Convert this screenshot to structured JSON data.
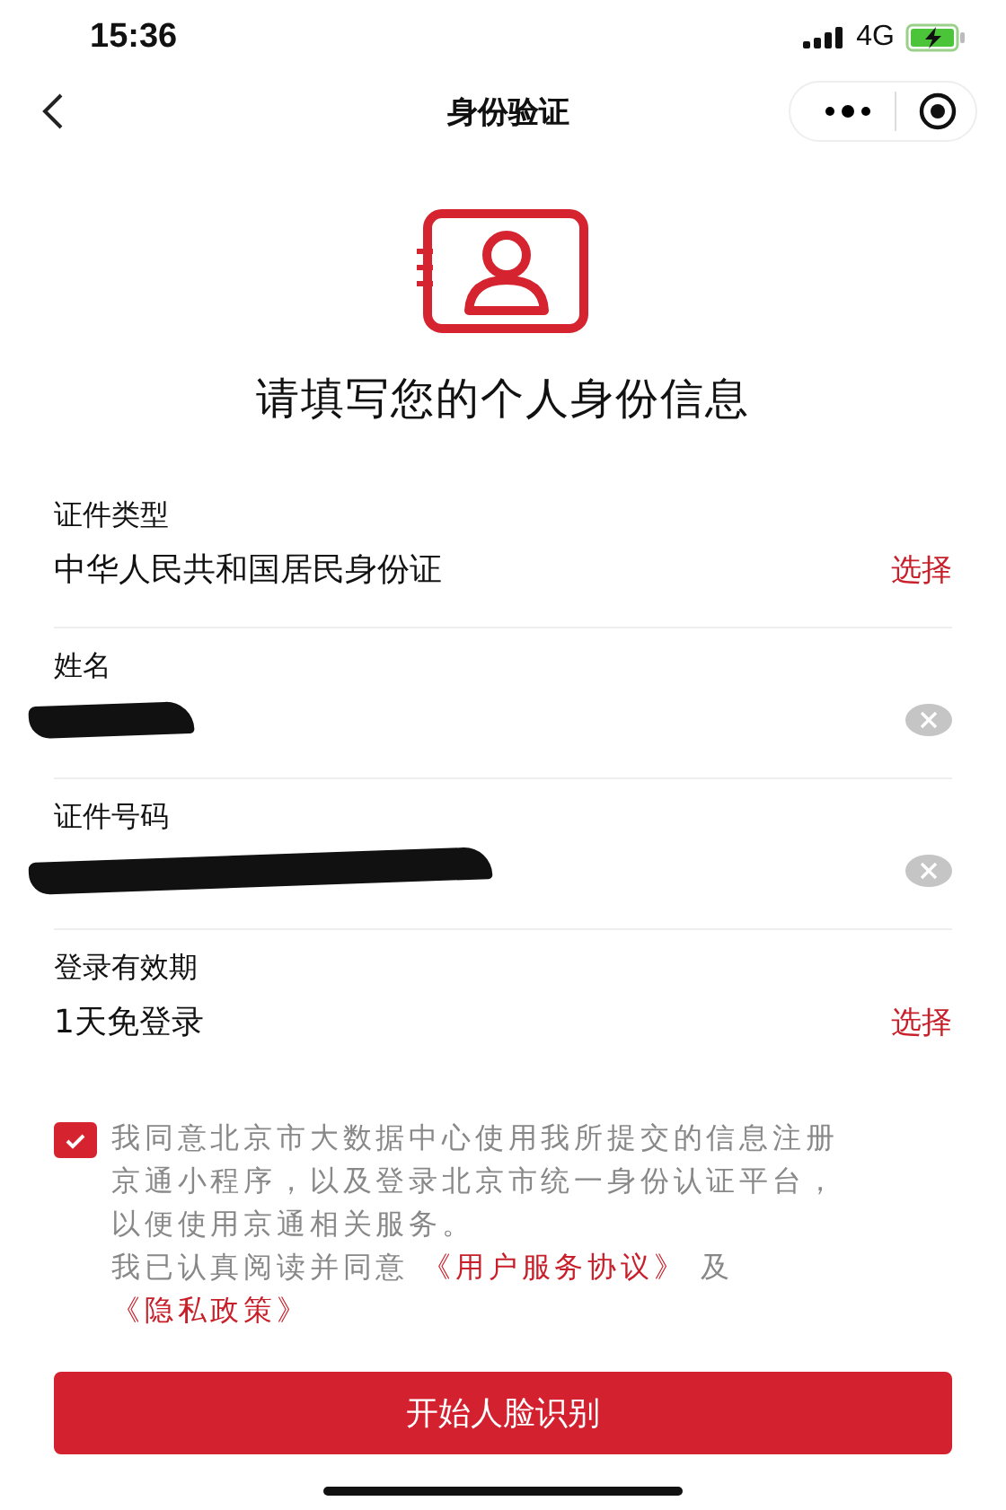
{
  "status_bar": {
    "time": "15:36",
    "network": "4G"
  },
  "nav_bar": {
    "title": "身份验证"
  },
  "heading": "请填写您的个人身份信息",
  "fields": [
    {
      "kind": "select",
      "label": "证件类型",
      "value": "中华人民共和国居民身份证",
      "action": "选择"
    },
    {
      "kind": "input",
      "label": "姓名",
      "redacted": true
    },
    {
      "kind": "input",
      "label": "证件号码",
      "redacted": true
    },
    {
      "kind": "select",
      "label": "登录有效期",
      "value": "1天免登录",
      "action": "选择"
    }
  ],
  "agreement": {
    "checked": true,
    "text": "我同意北京市大数据中心使用我所提交的信息注册京通小程序，以及登录北京市统一身份认证平台，以便使用京通相关服务。",
    "read_prefix": "我已认真阅读并同意",
    "links": [
      "《用户服务协议》",
      "《隐私政策》"
    ],
    "joiner": "及"
  },
  "submit_button": "开始人脸识别"
}
